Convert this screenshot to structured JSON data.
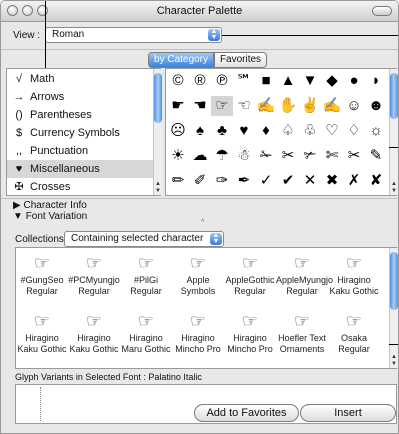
{
  "window": {
    "title": "Character Palette"
  },
  "view": {
    "label": "View :",
    "value": "Roman"
  },
  "tabs": [
    {
      "label": "by Category",
      "selected": true
    },
    {
      "label": "Favorites",
      "selected": false
    }
  ],
  "categories": [
    {
      "icon": "√",
      "label": "Math"
    },
    {
      "icon": "→",
      "label": "Arrows"
    },
    {
      "icon": "()",
      "label": "Parentheses"
    },
    {
      "icon": "$",
      "label": "Currency Symbols"
    },
    {
      "icon": ",,",
      "label": "Punctuation"
    },
    {
      "icon": "♥",
      "label": "Miscellaneous",
      "selected": true
    },
    {
      "icon": "✠",
      "label": "Crosses"
    }
  ],
  "glyphs": [
    [
      "©",
      "®",
      "℗",
      "℠",
      "■",
      "▲",
      "▼",
      "◆",
      "●",
      "◗"
    ],
    [
      "☛",
      "☚",
      "☞",
      "☜",
      "✍",
      "✋",
      "✌",
      "✍",
      "☺",
      "☻"
    ],
    [
      "☹",
      "♠",
      "♣",
      "♥",
      "♦",
      "♤",
      "♧",
      "♡",
      "♢",
      "☼"
    ],
    [
      "☀",
      "☁",
      "☂",
      "☃",
      "✁",
      "✂",
      "✃",
      "✄",
      "✂",
      "✎"
    ],
    [
      "✏",
      "✐",
      "✑",
      "✒",
      "✓",
      "✔",
      "✕",
      "✖",
      "✗",
      "✘"
    ]
  ],
  "info": {
    "character_info": "Character Info",
    "font_variation": "Font Variation"
  },
  "collections": {
    "label": "Collections :",
    "value": "Containing selected character"
  },
  "fonts": [
    {
      "name": "#GungSeo Regular",
      "glyph": "☞"
    },
    {
      "name": "#PCMyungjo Regular",
      "glyph": "☞"
    },
    {
      "name": "#PilGi Regular",
      "glyph": "☞"
    },
    {
      "name": "Apple Symbols",
      "glyph": "☞"
    },
    {
      "name": "AppleGothic Regular",
      "glyph": "☞"
    },
    {
      "name": "AppleMyungjo Regular",
      "glyph": "☞"
    },
    {
      "name": "Hiragino Kaku Gothic",
      "glyph": "☞"
    },
    {
      "name": "Hiragino Kaku Gothic",
      "glyph": "☞"
    },
    {
      "name": "Hiragino Kaku Gothic",
      "glyph": "☞"
    },
    {
      "name": "Hiragino Maru Gothic",
      "glyph": "☞"
    },
    {
      "name": "Hiragino Mincho Pro",
      "glyph": "☞"
    },
    {
      "name": "Hiragino Mincho Pro",
      "glyph": "☞"
    },
    {
      "name": "Hoefler Text Ornaments",
      "glyph": "☞"
    },
    {
      "name": "Osaka Regular",
      "glyph": "☞"
    }
  ],
  "glyph_variants": {
    "label": "Glyph Variants in Selected Font : Palatino Italic"
  },
  "buttons": {
    "add_favorites": "Add to Favorites",
    "insert": "Insert"
  }
}
